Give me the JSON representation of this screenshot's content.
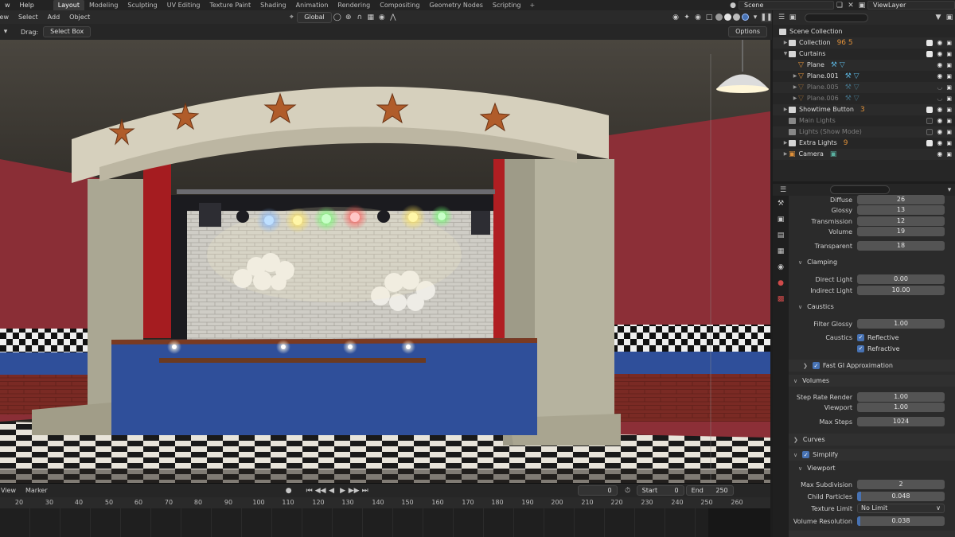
{
  "topbar": {
    "menus": [
      "w",
      "Help"
    ],
    "workspaces": [
      "Layout",
      "Modeling",
      "Sculpting",
      "UV Editing",
      "Texture Paint",
      "Shading",
      "Animation",
      "Rendering",
      "Compositing",
      "Geometry Nodes",
      "Scripting"
    ],
    "active_workspace": "Layout",
    "add_tab": "+",
    "scene": "Scene",
    "view_layer": "ViewLayer"
  },
  "viewport_header": {
    "menus": [
      "View",
      "Select",
      "Add",
      "Object"
    ],
    "orientation": "Global",
    "drag_label": "Drag:",
    "drag_value": "Select Box",
    "options": "Options"
  },
  "timeline": {
    "menus": [
      "View",
      "Marker"
    ],
    "current_frame": "0",
    "start_label": "Start",
    "start": "0",
    "end_label": "End",
    "end": "250",
    "ruler": [
      "20",
      "30",
      "40",
      "50",
      "60",
      "70",
      "80",
      "90",
      "100",
      "110",
      "120",
      "130",
      "140",
      "150",
      "160",
      "170",
      "180",
      "190",
      "200",
      "210",
      "220",
      "230",
      "240",
      "250",
      "260"
    ]
  },
  "outliner": {
    "rows": [
      {
        "label": "Scene Collection",
        "type": "scene",
        "indent": 0
      },
      {
        "label": "Collection",
        "type": "collection",
        "indent": 1,
        "extras": "96 5"
      },
      {
        "label": "Curtains",
        "type": "collection",
        "indent": 1
      },
      {
        "label": "Plane",
        "type": "mesh",
        "indent": 2
      },
      {
        "label": "Plane.001",
        "type": "mesh",
        "indent": 2
      },
      {
        "label": "Plane.005",
        "type": "mesh",
        "indent": 2,
        "dim": true
      },
      {
        "label": "Plane.006",
        "type": "mesh",
        "indent": 2,
        "dim": true
      },
      {
        "label": "Showtime Button",
        "type": "collection",
        "indent": 1,
        "extras": "3"
      },
      {
        "label": "Main Lights",
        "type": "collection",
        "indent": 1,
        "dim": true
      },
      {
        "label": "Lights (Show Mode)",
        "type": "collection",
        "indent": 1,
        "dim": true
      },
      {
        "label": "Extra Lights",
        "type": "collection",
        "indent": 1,
        "extras": "9"
      },
      {
        "label": "Camera",
        "type": "camera",
        "indent": 1
      }
    ]
  },
  "properties": {
    "bounces": [
      {
        "label": "Diffuse",
        "value": "26"
      },
      {
        "label": "Glossy",
        "value": "13"
      },
      {
        "label": "Transmission",
        "value": "12"
      },
      {
        "label": "Volume",
        "value": "19"
      },
      {
        "label": "Transparent",
        "value": "18"
      }
    ],
    "clamping": {
      "title": "Clamping",
      "direct_label": "Direct Light",
      "direct": "0.00",
      "indirect_label": "Indirect Light",
      "indirect": "10.00"
    },
    "caustics": {
      "title": "Caustics",
      "filter_label": "Filter Glossy",
      "filter": "1.00",
      "caustics_label": "Caustics",
      "reflective": "Reflective",
      "refractive": "Refractive"
    },
    "fast_gi": "Fast GI Approximation",
    "volumes": {
      "title": "Volumes",
      "step_label": "Step Rate Render",
      "step": "1.00",
      "viewport_label": "Viewport",
      "viewport": "1.00",
      "max_steps_label": "Max Steps",
      "max_steps": "1024"
    },
    "curves": "Curves",
    "simplify": {
      "title": "Simplify",
      "sub": "Viewport",
      "max_sub_label": "Max Subdivision",
      "max_sub": "2",
      "child_label": "Child Particles",
      "child": "0.048",
      "child_fraction": 0.048,
      "texture_label": "Texture Limit",
      "texture": "No Limit",
      "volres_label": "Volume Resolution",
      "volres": "0.038",
      "volres_fraction": 0.038
    }
  },
  "colors": {
    "accent": "#4772b3",
    "orange": "#e0913a",
    "wall_red": "#8a2e36",
    "stage_blue": "#2f4f9a"
  }
}
